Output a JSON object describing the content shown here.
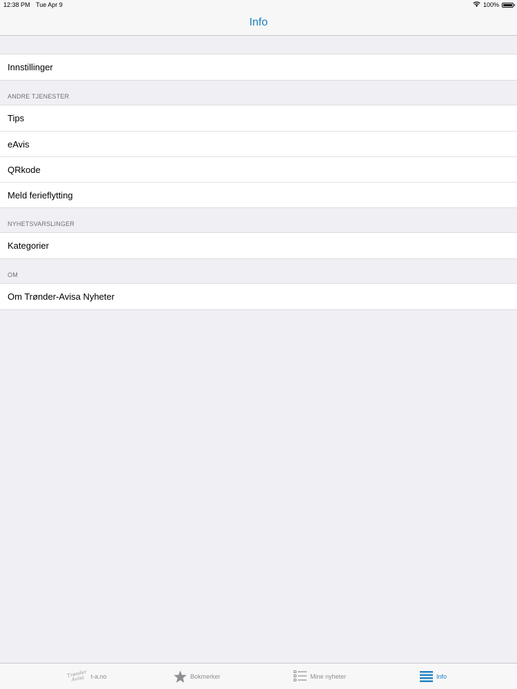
{
  "status_bar": {
    "time": "12:38 PM",
    "date": "Tue Apr 9",
    "battery": "100%",
    "battery_level": 1.0
  },
  "nav": {
    "title": "Info"
  },
  "sections": {
    "settings": {
      "items": [
        "Innstillinger"
      ]
    },
    "other_services": {
      "header": "ANDRE TJENESTER",
      "items": [
        "Tips",
        "eAvis",
        "QRkode",
        "Meld ferieflytting"
      ]
    },
    "news_alerts": {
      "header": "NYHETSVARSLINGER",
      "items": [
        "Kategorier"
      ]
    },
    "about": {
      "header": "OM",
      "items": [
        "Om Trønder-Avisa Nyheter"
      ]
    }
  },
  "tab_bar": {
    "tabs": [
      {
        "label": "t-a.no",
        "icon": "trønder-avisa-logo-icon",
        "logo_text_1": "Trønder",
        "logo_text_2": "Avisa"
      },
      {
        "label": "Bokmerker",
        "icon": "star-icon"
      },
      {
        "label": "Mine nyheter",
        "icon": "list-icon"
      },
      {
        "label": "Info",
        "icon": "info-list-icon"
      }
    ],
    "active_index": 3
  },
  "colors": {
    "accent": "#1a7fbf",
    "background": "#efeff4",
    "inactive": "#8e8e93"
  }
}
